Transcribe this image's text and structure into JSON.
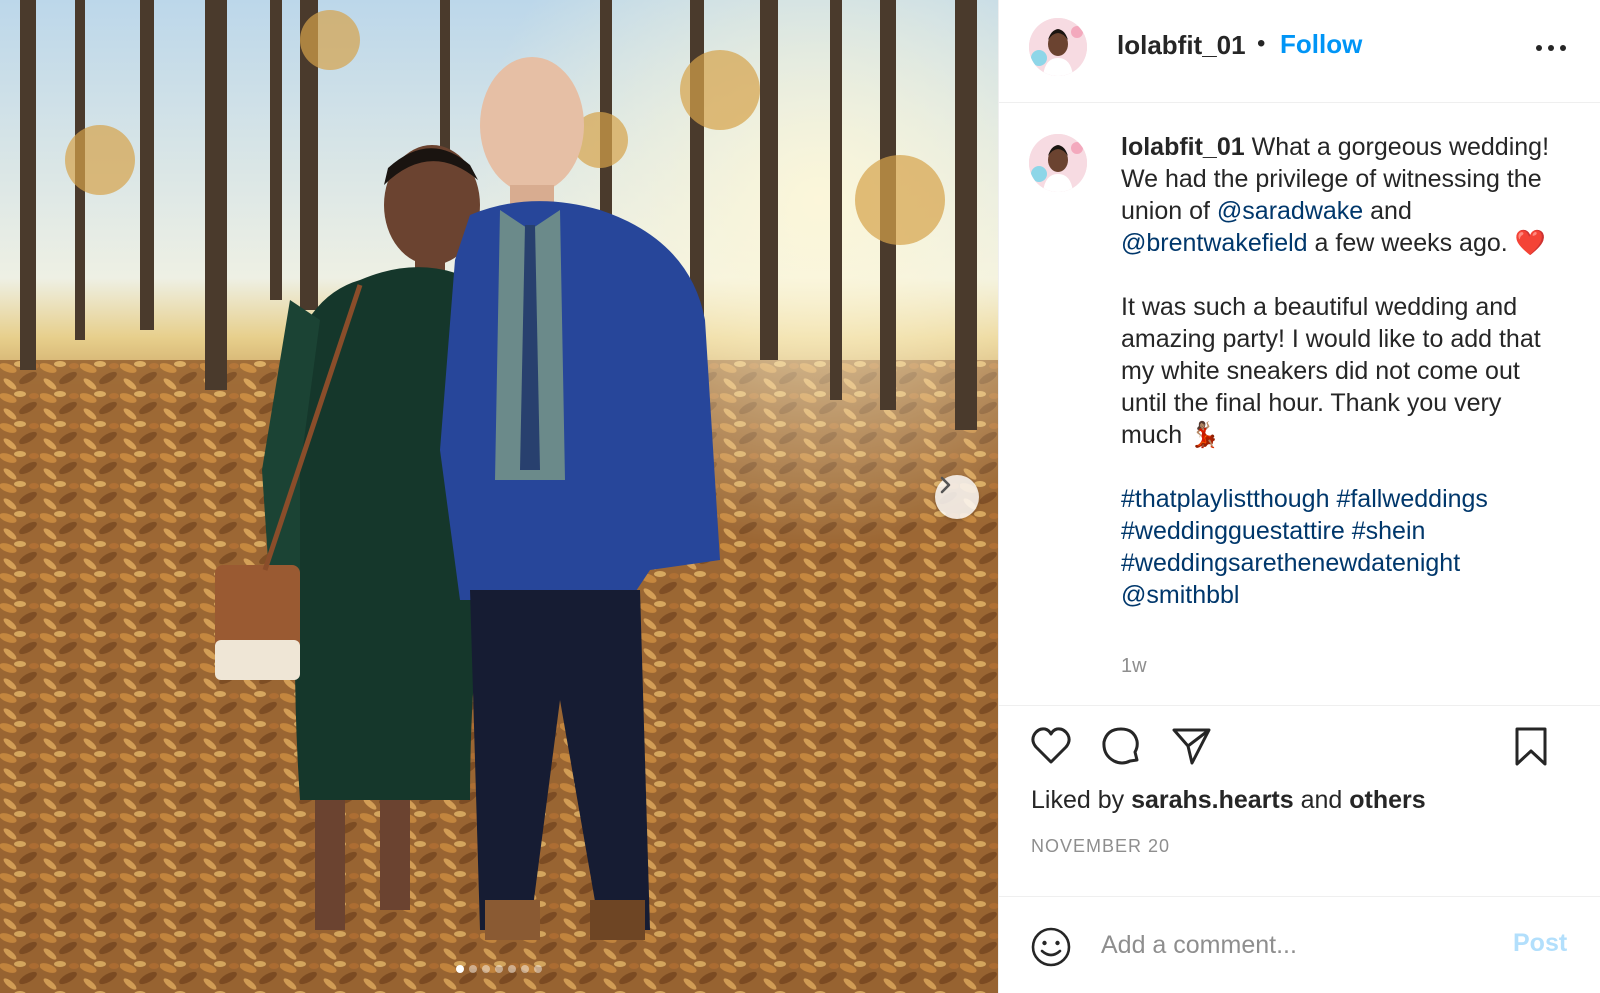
{
  "post": {
    "photo_alt": "photo",
    "carousel": {
      "count": 7,
      "active_index": 0,
      "next_icon": "chevron-right-icon"
    }
  },
  "header": {
    "username": "lolabfit_01",
    "separator": "•",
    "follow_label": "Follow",
    "more_icon": "more-options-icon"
  },
  "caption": {
    "username": "lolabfit_01",
    "p1_a": " What a gorgeous wedding! We had the privilege of witnessing the union of ",
    "mention1": "@saradwake",
    "p1_b": " and ",
    "mention2": "@brentwakefield",
    "p1_c": " a few weeks ago. ",
    "p1_emoji": "❤️",
    "p2": "It was such a beautiful wedding and amazing party! I would like to add that my white sneakers did not come out until the final hour. Thank you very much ",
    "p2_emoji": "💃🏽",
    "tag1": "#thatplaylistthough",
    "tag2": "#fallweddings",
    "tag3": "#weddingguestattire",
    "tag4": "#shein",
    "tag5": "#weddingsarethenewdatenight",
    "mention3": "@smithbbl",
    "time": "1w"
  },
  "actions": {
    "like_icon": "heart-icon",
    "comment_icon": "comment-icon",
    "share_icon": "send-icon",
    "save_icon": "bookmark-icon"
  },
  "likes": {
    "prefix": "Liked by ",
    "user": "sarahs.hearts",
    "middle": " and ",
    "others": "others"
  },
  "date": "NOVEMBER 20",
  "comment": {
    "emoji_icon": "smiley-icon",
    "placeholder": "Add a comment...",
    "post_label": "Post"
  },
  "colors": {
    "accent": "#0095f6",
    "link": "#00376b",
    "muted": "#8e8e8e",
    "post_disabled": "#b2dffc",
    "border": "#efefef"
  }
}
